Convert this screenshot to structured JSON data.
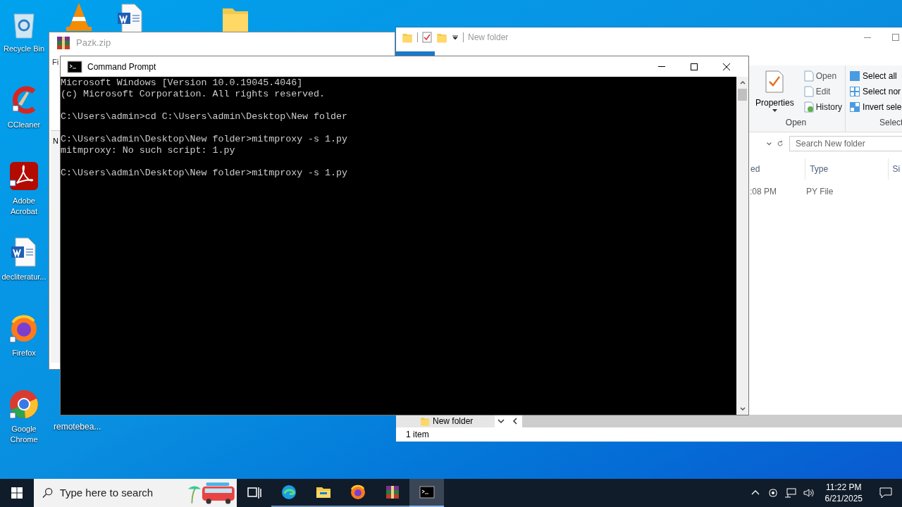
{
  "desktop": {
    "icons": [
      {
        "kind": "recycle",
        "label": "Recycle Bin"
      },
      {
        "kind": "ccleaner",
        "label": "CCleaner"
      },
      {
        "kind": "acrobat",
        "label": "Adobe Acrobat"
      },
      {
        "kind": "word",
        "label": "decliteratur..."
      },
      {
        "kind": "firefox",
        "label": "Firefox"
      },
      {
        "kind": "chrome",
        "label": "Google Chrome"
      }
    ],
    "extra_label": "remotebea..."
  },
  "archive_window": {
    "title": "Pazk.zip",
    "menu_text": "Fi",
    "pane_text": "N"
  },
  "explorer": {
    "title": "New folder",
    "ribbon": {
      "properties": "Properties",
      "open_items": [
        "Open",
        "Edit",
        "History"
      ],
      "open_group": "Open",
      "select_items": [
        "Select all",
        "Select nor",
        "Invert sele"
      ],
      "select_group": "Select"
    },
    "search": {
      "placeholder": "Search New folder"
    },
    "columns": [
      "ed",
      "Type",
      "Si"
    ],
    "rows": [
      {
        "cells": [
          ":08 PM",
          "PY File"
        ]
      }
    ],
    "nav_item": "New folder",
    "status": "1 item"
  },
  "cmd": {
    "title": "Command Prompt",
    "blocks": [
      [
        "Microsoft Windows [Version 10.0.19045.4046]",
        "(c) Microsoft Corporation. All rights reserved."
      ],
      [
        "C:\\Users\\admin>cd C:\\Users\\admin\\Desktop\\New folder"
      ],
      [
        "C:\\Users\\admin\\Desktop\\New folder>mitmproxy -s 1.py",
        "mitmproxy: No such script: 1.py"
      ],
      [
        "C:\\Users\\admin\\Desktop\\New folder>mitmproxy -s 1.py"
      ]
    ]
  },
  "taskbar": {
    "search": {
      "placeholder": "Type here to search"
    },
    "apps": [
      {
        "kind": "taskview",
        "selected": false
      },
      {
        "kind": "edge",
        "selected": false
      },
      {
        "kind": "explorer",
        "selected": false
      },
      {
        "kind": "firefox",
        "selected": false
      },
      {
        "kind": "winrar",
        "selected": false
      },
      {
        "kind": "cmd",
        "selected": true
      }
    ],
    "time": "11:22 PM",
    "date": "6/21/2025"
  }
}
